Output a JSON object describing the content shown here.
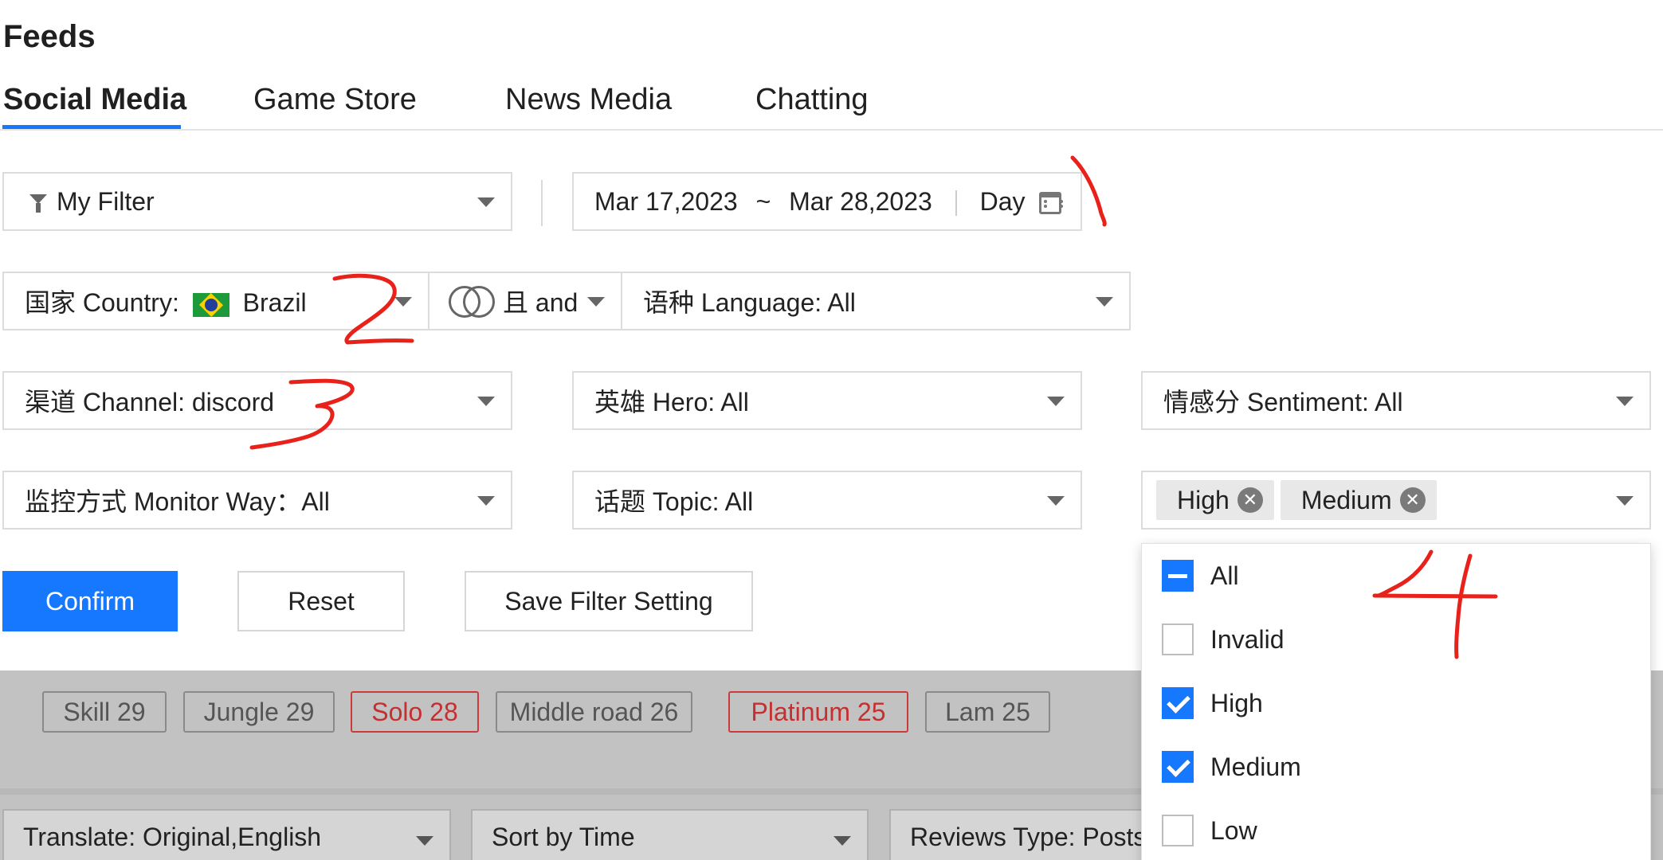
{
  "page": {
    "title": "Feeds"
  },
  "tabs": [
    "Social Media",
    "Game Store",
    "News Media",
    "Chatting"
  ],
  "filter": {
    "my_filter": "My Filter",
    "date_start": "Mar 17,2023",
    "date_tilde": "~",
    "date_end": "Mar 28,2023",
    "granularity": "Day",
    "country_label": "国家 Country:",
    "country_value": "Brazil",
    "logic": "且 and",
    "language": "语种 Language: All",
    "channel": "渠道 Channel: discord",
    "hero": "英雄 Hero: All",
    "sentiment": "情感分 Sentiment: All",
    "monitor_way": "监控方式 Monitor Way：All",
    "topic": "话题 Topic: All",
    "selected_levels": [
      "High",
      "Medium"
    ]
  },
  "buttons": {
    "confirm": "Confirm",
    "reset": "Reset",
    "save": "Save Filter Setting"
  },
  "dropdown": {
    "options": [
      {
        "label": "All",
        "state": "partial"
      },
      {
        "label": "Invalid",
        "state": "unchecked"
      },
      {
        "label": "High",
        "state": "checked"
      },
      {
        "label": "Medium",
        "state": "checked"
      },
      {
        "label": "Low",
        "state": "unchecked"
      }
    ]
  },
  "tags": [
    {
      "label": "Skill 29",
      "color": "#555555"
    },
    {
      "label": "Jungle 29",
      "color": "#555555"
    },
    {
      "label": "Solo 28",
      "color": "#c62f2f"
    },
    {
      "label": "Middle road 26",
      "color": "#555555"
    },
    {
      "label": "Platinum 25",
      "color": "#c62f2f"
    },
    {
      "label": "Lam 25",
      "color": "#555555"
    }
  ],
  "bottom_bar": {
    "translate": "Translate: Original,English",
    "sort": "Sort by Time",
    "reviews_type": "Reviews Type: Posts"
  },
  "colors": {
    "accent": "#1677ff",
    "annotation": "#e8211a",
    "overlay": "#c2c2c2"
  },
  "icons": [
    "filter-icon",
    "calendar-icon",
    "brazil-flag-icon",
    "intersection-icon",
    "close-icon",
    "chevron-down-icon"
  ],
  "annotations": [
    "1",
    "2",
    "3",
    "4"
  ]
}
